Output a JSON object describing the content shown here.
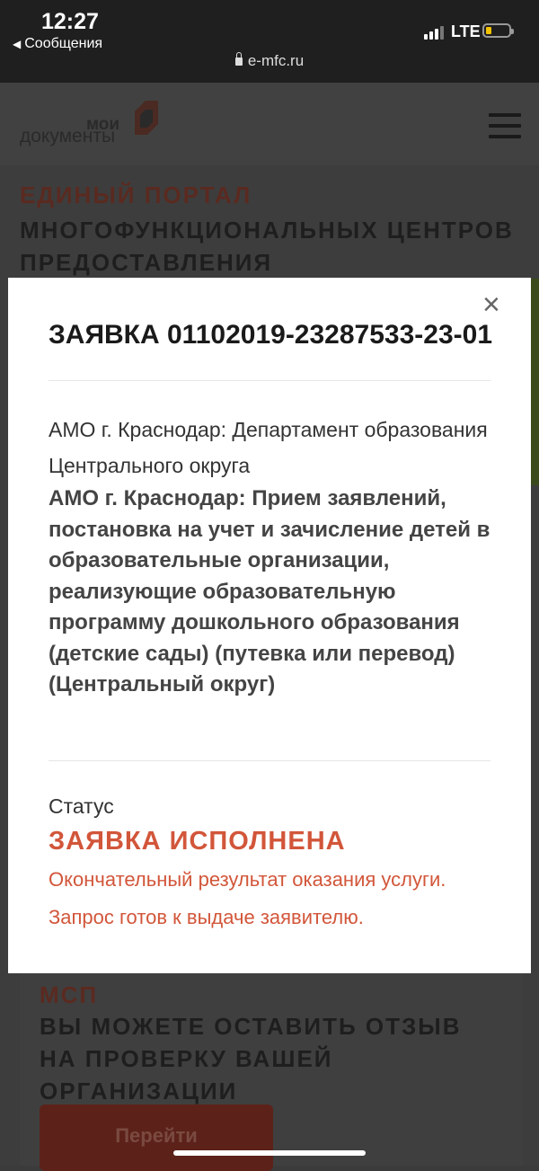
{
  "status_bar": {
    "time": "12:27",
    "back_label": "Сообщения",
    "network": "LTE",
    "url": "e-mfc.ru"
  },
  "header": {
    "logo_top": "мои",
    "logo_bottom": "документы"
  },
  "page": {
    "portal_line1": "ЕДИНЫЙ ПОРТАЛ",
    "portal_line2": "МНОГОФУНКЦИОНАЛЬНЫХ ЦЕНТРОВ ПРЕДОСТАВЛЕНИЯ",
    "msp": "МСП",
    "feedback": "ВЫ МОЖЕТЕ ОСТАВИТЬ ОТЗЫВ НА ПРОВЕРКУ ВАШЕЙ ОРГАНИЗАЦИИ",
    "go_button": "Перейти"
  },
  "modal": {
    "close": "×",
    "title": "ЗАЯВКА 01102019-23287533-23-01",
    "department": "АМО г. Краснодар: Департамент образования Центрального округа",
    "service": "АМО г. Краснодар: Прием заявлений, постановка на учет и зачисление детей в образовательные организации, реализующие образовательную программу дошкольного образования (детские сады) (путевка или перевод) (Центральный округ)",
    "status_label": "Статус",
    "status_value": "ЗАЯВКА ИСПОЛНЕНА",
    "status_description": "Окончательный результат оказания услуги. Запрос готов к выдаче заявителю."
  },
  "colors": {
    "accent": "#d2563a",
    "overlay": "#3d3d3d",
    "modal_bg": "#ffffff"
  }
}
